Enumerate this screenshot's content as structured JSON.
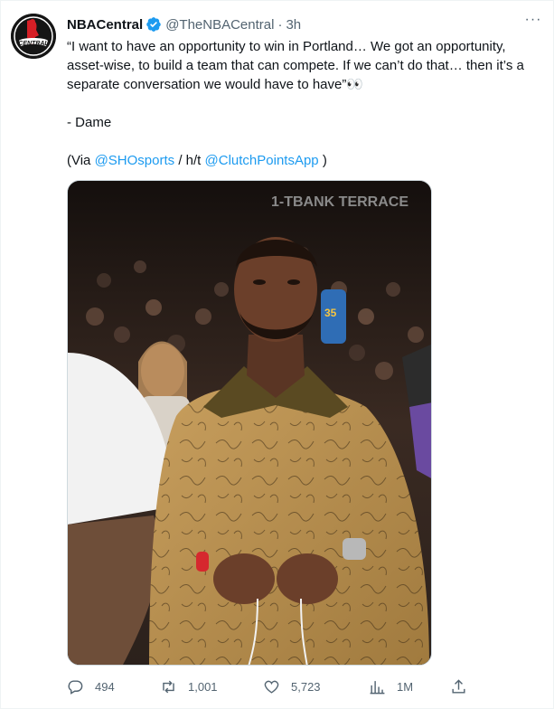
{
  "author": {
    "display_name": "NBACentral",
    "handle": "@TheNBACentral",
    "separator": "·",
    "time": "3h",
    "avatar_text": "CENTRAL"
  },
  "menu": {
    "more_label": "···"
  },
  "tweet": {
    "quote": "“I want to have an opportunity to win in Portland… We got an opportunity, asset-wise, to build a team that can compete. If we can’t do that… then it’s a separate conversation we would have to have”👀",
    "signoff": "- Dame",
    "via_open": "(Via ",
    "via_mention": "@SHOsports",
    "ht_text": " / h/t ",
    "ht_mention": "@ClutchPointsApp",
    "via_close": " )"
  },
  "media": {
    "arena_sign": "1-TBANK TERRACE",
    "jersey_number": "35"
  },
  "actions": {
    "replies": "494",
    "retweets": "1,001",
    "likes": "5,723",
    "views": "1M"
  },
  "colors": {
    "link": "#1d9bf0",
    "verified": "#1d9bf0",
    "secondary_text": "#536471",
    "primary_text": "#0f1419"
  },
  "icons": [
    "verified-badge-icon",
    "more-icon",
    "reply-icon",
    "retweet-icon",
    "like-icon",
    "views-icon",
    "share-icon"
  ]
}
